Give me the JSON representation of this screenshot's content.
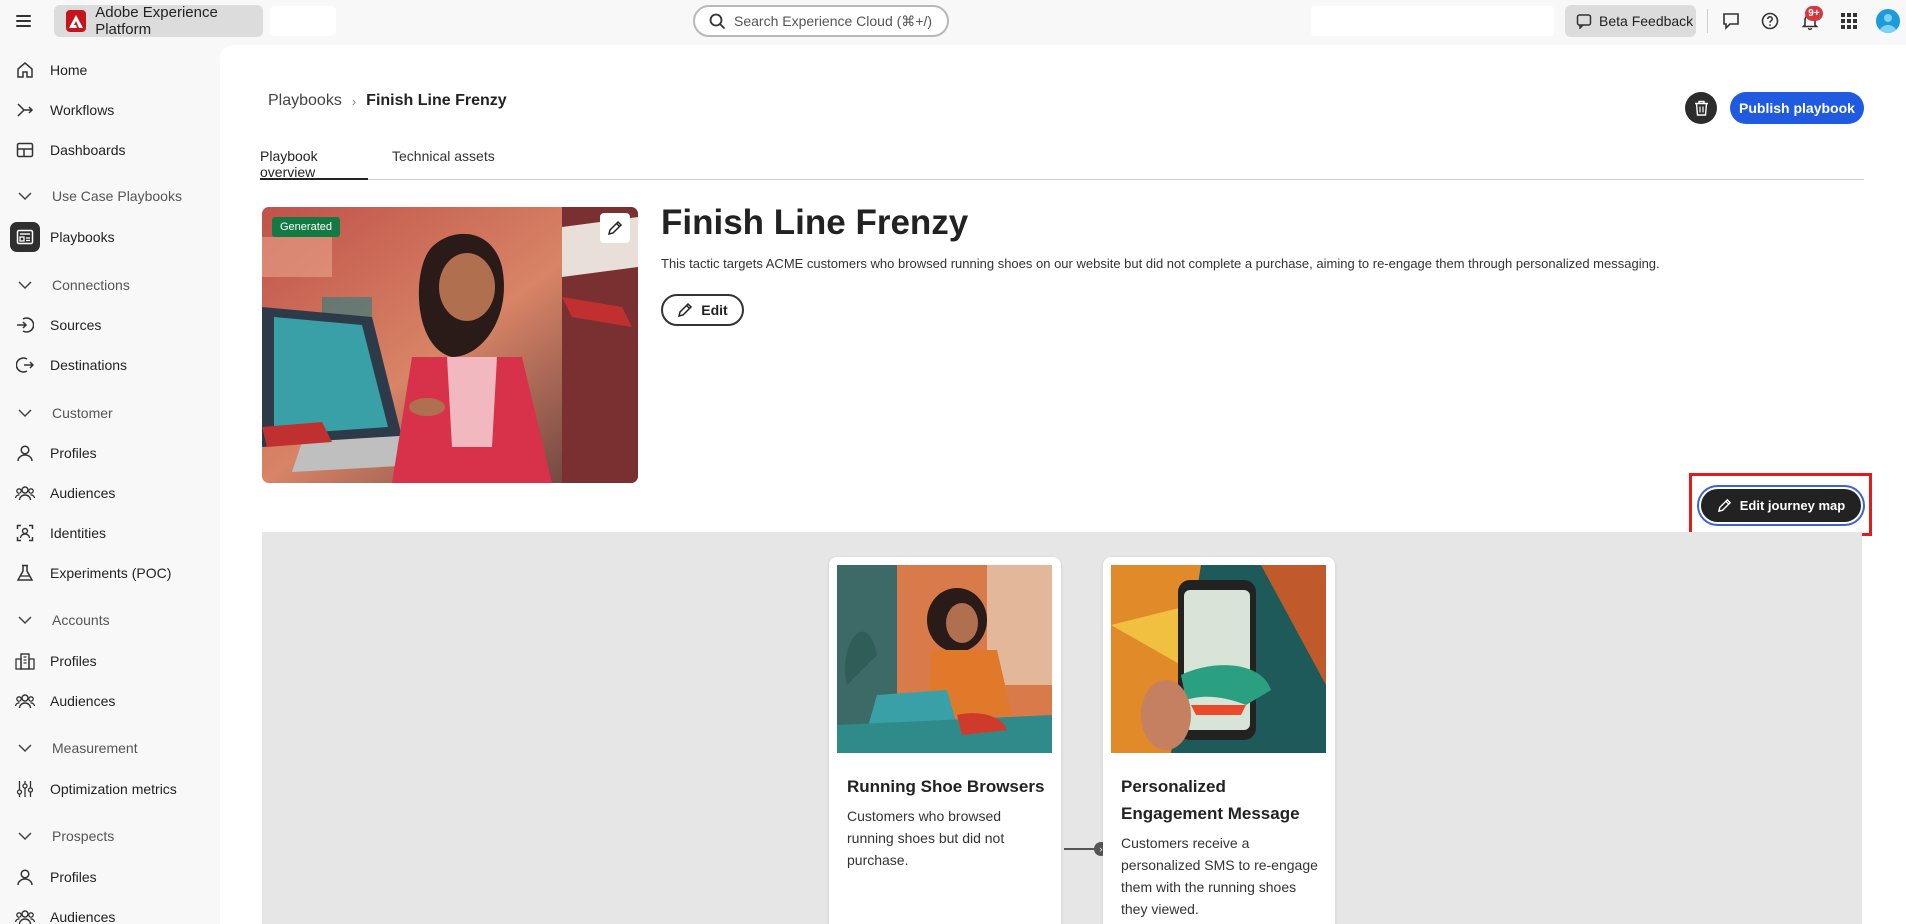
{
  "topbar": {
    "app_name": "Adobe Experience Platform",
    "search_placeholder": "Search Experience Cloud (⌘+/)",
    "beta_feedback": "Beta Feedback",
    "notification_count": "9+"
  },
  "sidebar": {
    "home": "Home",
    "workflows": "Workflows",
    "dashboards": "Dashboards",
    "group_use_case": "Use Case Playbooks",
    "playbooks": "Playbooks",
    "group_connections": "Connections",
    "sources": "Sources",
    "destinations": "Destinations",
    "group_customer": "Customer",
    "customer_profiles": "Profiles",
    "customer_audiences": "Audiences",
    "identities": "Identities",
    "experiments": "Experiments (POC)",
    "group_accounts": "Accounts",
    "accounts_profiles": "Profiles",
    "accounts_audiences": "Audiences",
    "group_measurement": "Measurement",
    "optimization_metrics": "Optimization metrics",
    "group_prospects": "Prospects",
    "prospects_profiles": "Profiles",
    "prospects_audiences": "Audiences"
  },
  "main": {
    "breadcrumb_parent": "Playbooks",
    "breadcrumb_current": "Finish Line Frenzy",
    "publish_label": "Publish playbook",
    "tabs": [
      "Playbook overview",
      "Technical assets"
    ],
    "generated_badge": "Generated",
    "title": "Finish Line Frenzy",
    "description": "This tactic targets ACME customers who browsed running shoes on our website but did not complete a purchase, aiming to re-engage them through personalized messaging.",
    "edit_label": "Edit",
    "edit_journey_label": "Edit journey map"
  },
  "journey": {
    "cards": [
      {
        "title": "Running Shoe Browsers",
        "text": "Customers who browsed running shoes but did not purchase."
      },
      {
        "title": "Personalized Engagement Message",
        "text": "Customers receive a personalized SMS to re-engage them with the running shoes they viewed."
      }
    ]
  }
}
